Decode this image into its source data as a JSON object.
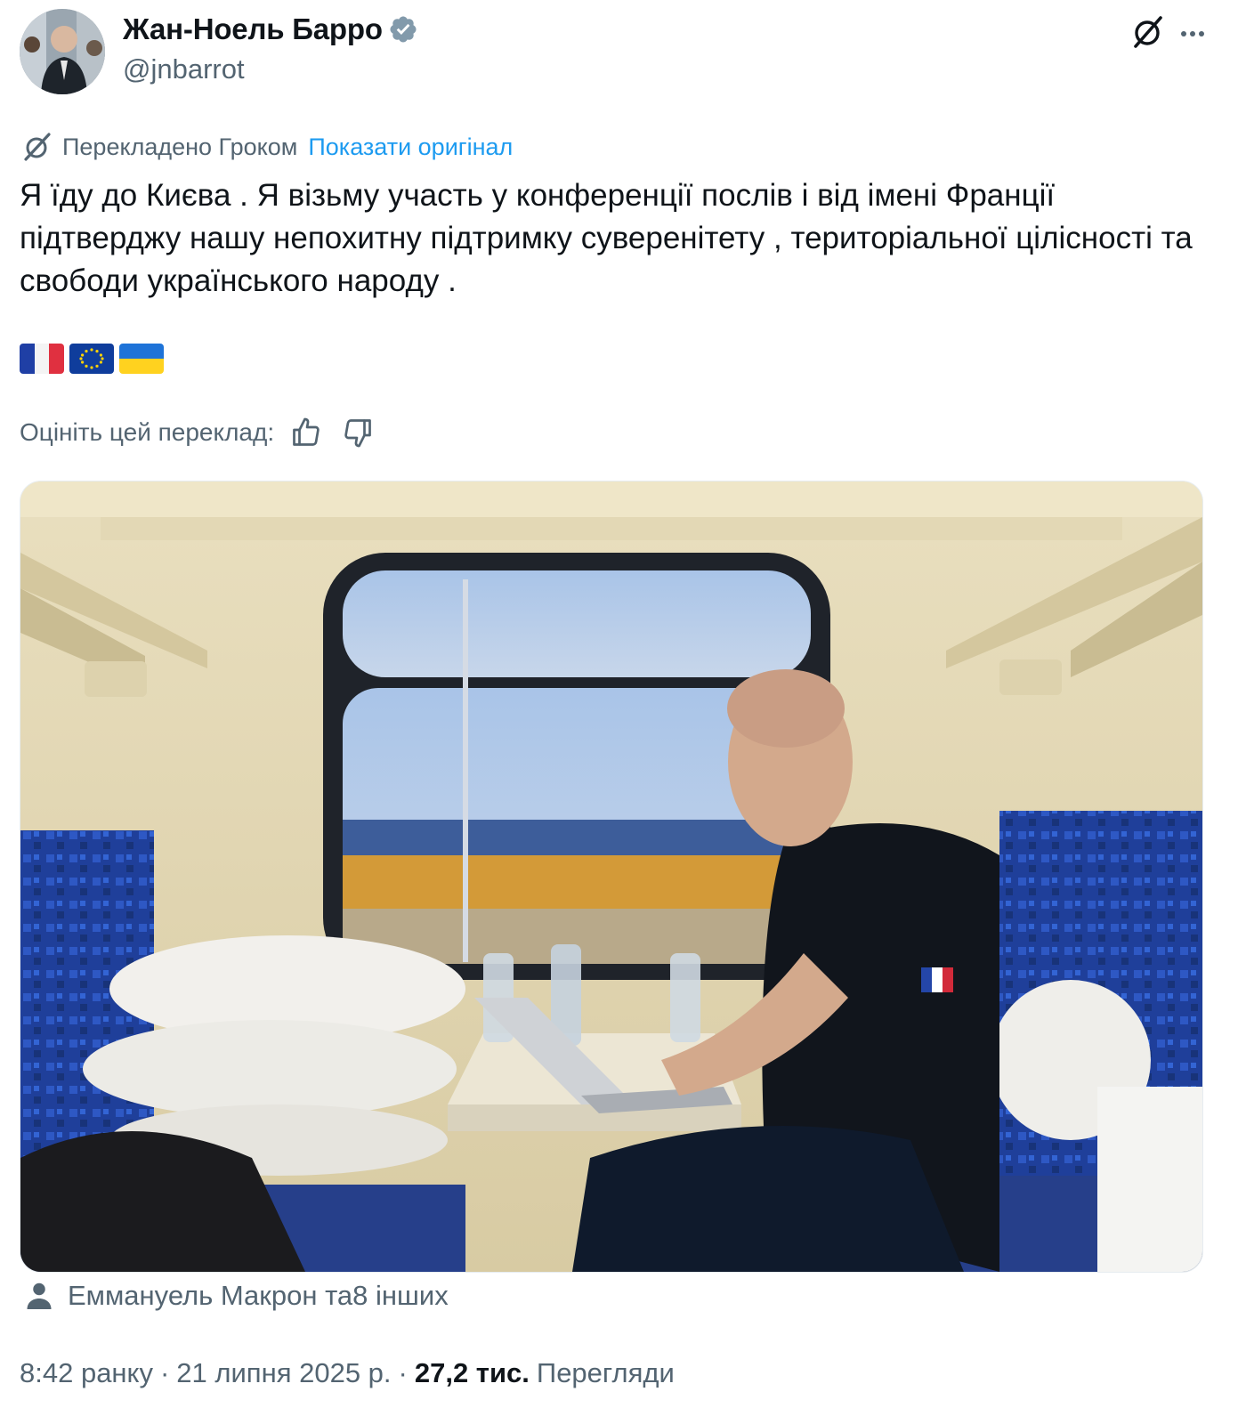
{
  "author": {
    "display_name": "Жан-Ноель Барро",
    "handle": "@jnbarrot",
    "verified": true
  },
  "header_icons": [
    "grok-icon",
    "more-icon"
  ],
  "translation": {
    "label": "Перекладено Гроком",
    "show_original": "Показати оригінал"
  },
  "tweet": {
    "text": "Я їду до Києва . Я візьму участь у конференції послів і від імені Франції підтверджу нашу непохитну підтримку суверенітету , територіальної цілісності та свободи українського народу ."
  },
  "flags": [
    "flag-france",
    "flag-eu",
    "flag-ukraine"
  ],
  "rating": {
    "label": "Оцініть цей переклад:"
  },
  "tagged": {
    "text": "Еммануель Макрон та8 інших"
  },
  "meta": {
    "time": "8:42 ранку",
    "sep1": "·",
    "date": "21 липня 2025 р.",
    "sep2": "·",
    "views_count": "27,2 тис.",
    "views_label": "Перегляди"
  },
  "colors": {
    "text": "#0f1419",
    "secondary": "#536471",
    "link": "#1d9bf0",
    "verified": "#829aab"
  }
}
